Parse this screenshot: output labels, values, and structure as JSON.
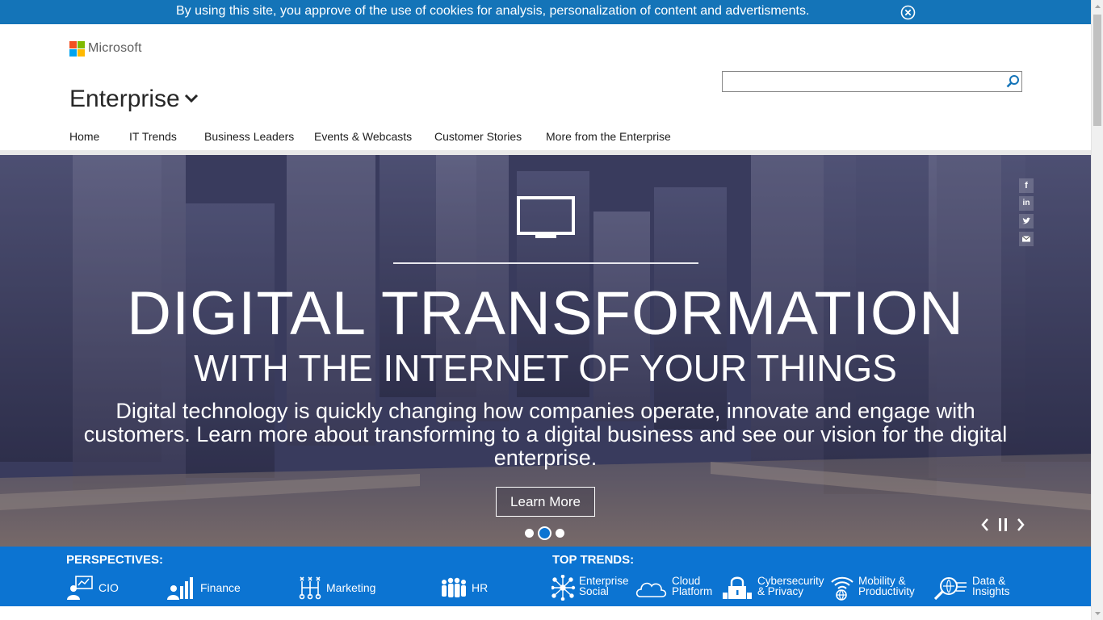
{
  "cookie_bar": {
    "text": "By using this site, you approve of the use of cookies for analysis, personalization of content and advertisments.",
    "close_icon": "close-circle-icon"
  },
  "header": {
    "logo_text": "Microsoft",
    "site_title": "Enterprise",
    "search": {
      "value": "",
      "placeholder": ""
    },
    "nav": [
      "Home",
      "IT Trends",
      "Business Leaders",
      "Events & Webcasts",
      "Customer Stories",
      "More from the Enterprise"
    ]
  },
  "hero": {
    "title": "DIGITAL TRANSFORMATION",
    "subtitle": "WITH THE INTERNET OF YOUR THINGS",
    "body": "Digital technology is quickly changing how companies operate, innovate and engage with customers. Learn more about transforming to a digital business and see our vision for the digital enterprise.",
    "cta": "Learn More",
    "slide_count": 3,
    "active_slide": 2,
    "social": [
      "facebook-icon",
      "linkedin-icon",
      "twitter-icon",
      "email-icon"
    ]
  },
  "band": {
    "perspectives_heading": "PERSPECTIVES:",
    "perspectives": [
      {
        "label": "CIO",
        "icon": "cio-icon"
      },
      {
        "label": "Finance",
        "icon": "finance-icon"
      },
      {
        "label": "Marketing",
        "icon": "marketing-icon"
      },
      {
        "label": "HR",
        "icon": "hr-icon"
      }
    ],
    "trends_heading": "TOP TRENDS:",
    "trends": [
      {
        "line1": "Enterprise",
        "line2": "Social",
        "icon": "enterprise-social-icon"
      },
      {
        "line1": "Cloud",
        "line2": "Platform",
        "icon": "cloud-icon"
      },
      {
        "line1": "Cybersecurity",
        "line2": "& Privacy",
        "icon": "lock-icon"
      },
      {
        "line1": "Mobility &",
        "line2": "Productivity",
        "icon": "wifi-globe-icon"
      },
      {
        "line1": "Data &",
        "line2": "Insights",
        "icon": "data-insights-icon"
      }
    ]
  },
  "colors": {
    "accent": "#0c74d2",
    "cookie_bar": "#1474b8"
  }
}
